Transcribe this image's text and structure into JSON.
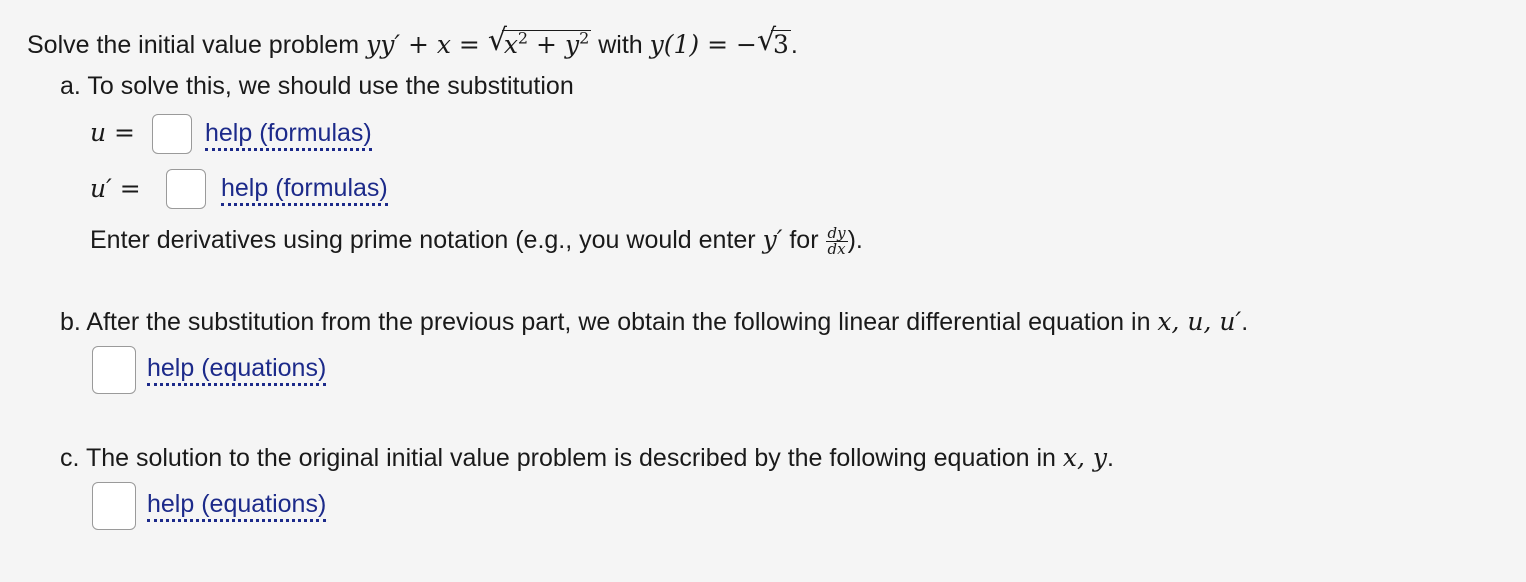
{
  "problem": {
    "intro": "Solve the initial value problem",
    "eq_lhs": "yy′ + x = ",
    "sqrt_inner_x": "x",
    "sqrt_inner_plus": " + ",
    "sqrt_inner_y": "y",
    "sq": "2",
    "with": "with",
    "ic": "y(1) = −",
    "ic_sqrt": "3",
    "period": "."
  },
  "part_a": {
    "label": "a. To solve this, we should use the substitution",
    "u_label": "u =",
    "uprime_label": "u′ =",
    "help_u": "help (formulas)",
    "help_uprime": "help (formulas)",
    "note_prefix": "Enter derivatives using prime notation (e.g., you would enter",
    "note_y": "y′",
    "note_for": "for",
    "frac_num": "dy",
    "frac_den": "dx",
    "note_suffix": ")."
  },
  "part_b": {
    "label": "b. After the substitution from the previous part, we obtain the following linear differential equation in",
    "vars": "x, u, u′",
    "period": ".",
    "help": "help (equations)"
  },
  "part_c": {
    "label": "c. The solution to the original initial value problem is described by the following equation in",
    "vars": "x, y",
    "period": ".",
    "help": "help (equations)"
  }
}
